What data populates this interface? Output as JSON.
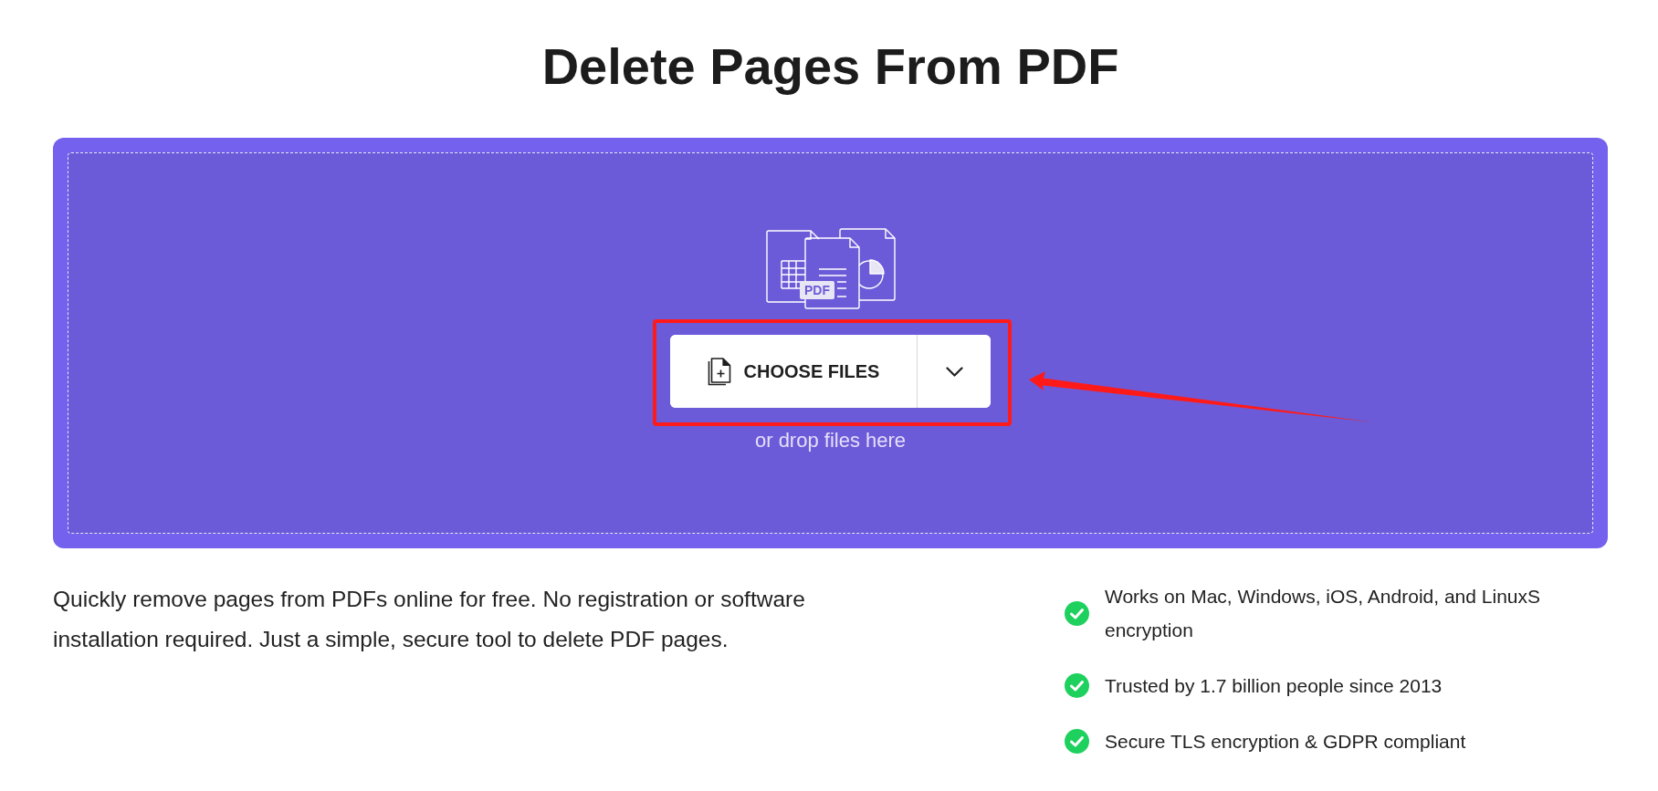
{
  "title": "Delete Pages From PDF",
  "upload": {
    "illustration_label": "PDF",
    "choose_button": "CHOOSE FILES",
    "drop_hint": "or drop files here"
  },
  "description": "Quickly remove pages from PDFs online for free. No registration or software installation required. Just a simple, secure tool to delete PDF pages.",
  "features": [
    "Works on Mac, Windows, iOS, Android, and LinuxS encryption",
    "Trusted by 1.7 billion people since 2013",
    "Secure TLS encryption & GDPR compliant"
  ],
  "annotation": {
    "frame": true,
    "arrow": true
  }
}
